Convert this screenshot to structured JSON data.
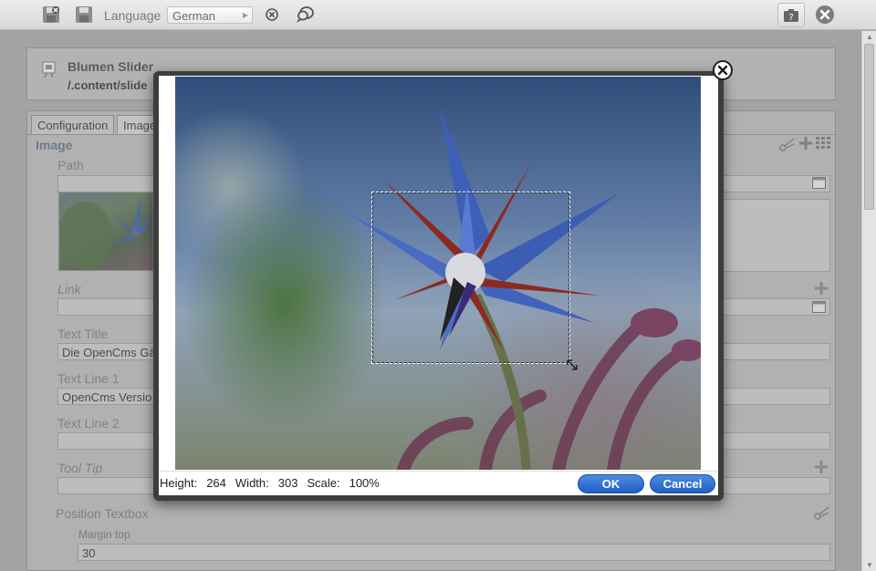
{
  "toolbar": {
    "language_label": "Language",
    "language_value": "German"
  },
  "header": {
    "title": "Blumen Slider",
    "path": "/.content/slide"
  },
  "tabs": [
    {
      "label": "Configuration"
    },
    {
      "label": "Image"
    }
  ],
  "form": {
    "section_title": "Image",
    "path_label": "Path",
    "link_label": "Link",
    "text_title_label": "Text Title",
    "text_title_value": "Die OpenCms Gä",
    "text_line1_label": "Text Line 1",
    "text_line1_value": "OpenCms Versio",
    "text_line2_label": "Text Line 2",
    "text_line2_value": "",
    "tooltip_label": "Tool Tip",
    "position_label": "Position Textbox",
    "margin_top_label": "Margin top",
    "margin_top_value": "30"
  },
  "dialog": {
    "height_label": "Height:",
    "height_value": "264",
    "width_label": "Width:",
    "width_value": "303",
    "scale_label": "Scale:",
    "scale_value": "100%",
    "ok_label": "OK",
    "cancel_label": "Cancel"
  }
}
